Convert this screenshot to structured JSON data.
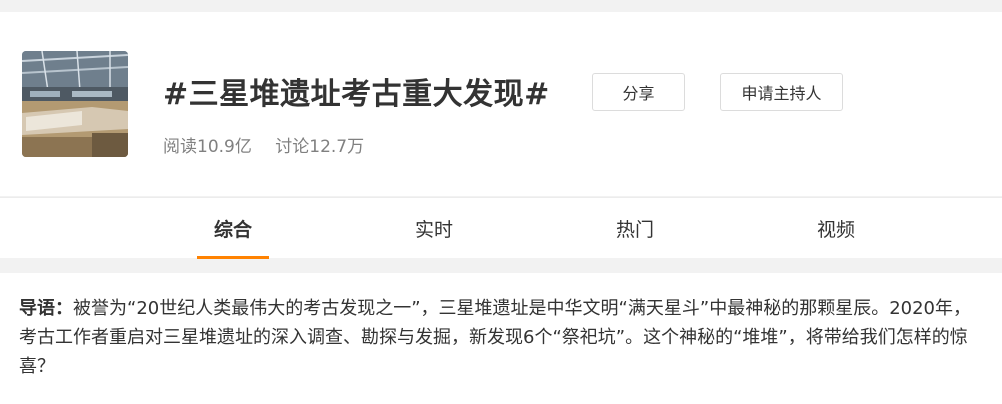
{
  "topic": {
    "title": "#三星堆遗址考古重大发现#",
    "reads": "阅读10.9亿",
    "discussions": "讨论12.7万",
    "share_label": "分享",
    "host_label": "申请主持人"
  },
  "tabs": [
    {
      "label": "综合",
      "active": true
    },
    {
      "label": "实时",
      "active": false
    },
    {
      "label": "热门",
      "active": false
    },
    {
      "label": "视频",
      "active": false
    }
  ],
  "intro": {
    "label": "导语：",
    "text": "被誉为“20世纪人类最伟大的考古发现之一”，三星堆遗址是中华文明“满天星斗”中最神秘的那颗星辰。2020年，考古工作者重启对三星堆遗址的深入调查、勘探与发掘，新发现6个“祭祀坑”。这个神秘的“堆堆”，将带给我们怎样的惊喜？"
  },
  "colors": {
    "accent": "#ff8200",
    "background": "#f2f2f2",
    "text": "#333333",
    "muted": "#808080"
  }
}
